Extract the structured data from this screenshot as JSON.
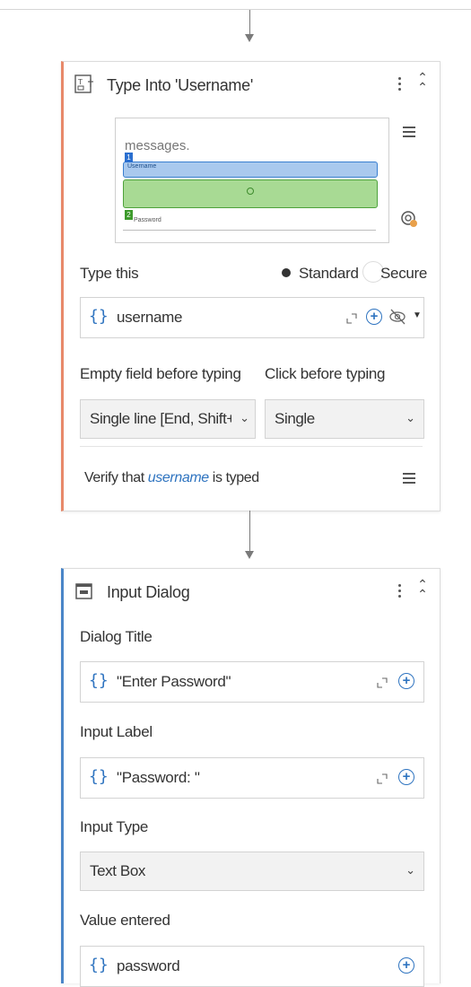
{
  "type_into": {
    "title": "Type Into 'Username'",
    "preview": {
      "messages_text": "messages.",
      "username_tag": "Username",
      "password_tag": "Password",
      "anchor_badge_1": "1",
      "anchor_badge_2": "2"
    },
    "type_this_label": "Type this",
    "mode_standard": "Standard",
    "mode_secure": "Secure",
    "mode_selected": "Standard",
    "type_this_value": "username",
    "empty_field_label": "Empty field before typing",
    "empty_field_value": "Single line [End, Shift+Home, Del]",
    "click_before_label": "Click before typing",
    "click_before_value": "Single",
    "verify_prefix": "Verify that ",
    "verify_variable": "username",
    "verify_suffix": " is typed"
  },
  "input_dialog": {
    "title": "Input Dialog",
    "dialog_title_label": "Dialog Title",
    "dialog_title_value": "\"Enter Password\"",
    "input_label_label": "Input Label",
    "input_label_value": "\"Password: \"",
    "input_type_label": "Input Type",
    "input_type_value": "Text Box",
    "value_entered_label": "Value entered",
    "value_entered_value": "password"
  },
  "colors": {
    "accent_blue": "#2f74c0",
    "type_into_accent": "#e8896a",
    "input_dialog_accent": "#4a86c8"
  }
}
